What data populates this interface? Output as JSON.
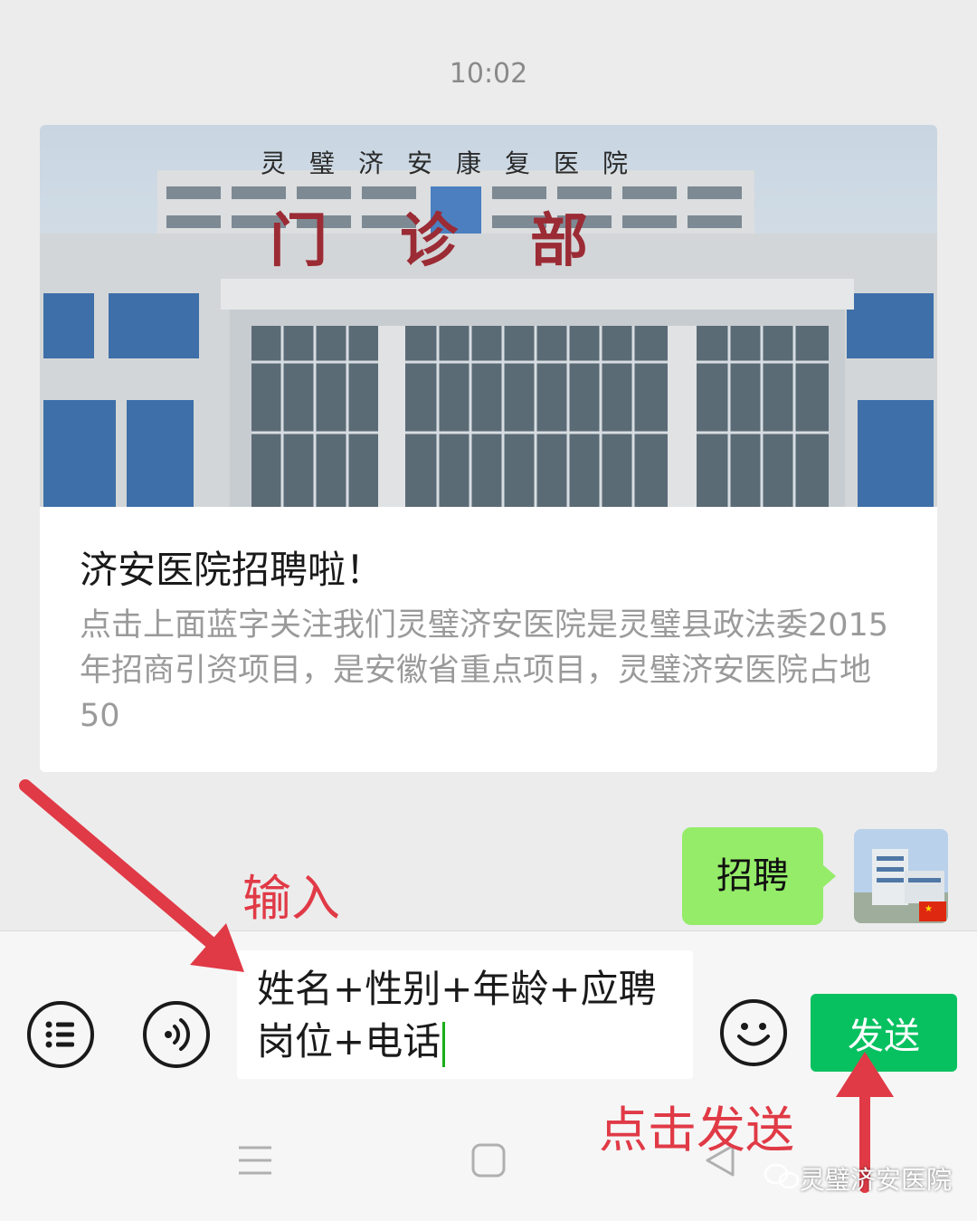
{
  "status": {
    "time": "10:02"
  },
  "article": {
    "title": "济安医院招聘啦！",
    "summary": "点击上面蓝字关注我们灵璧济安医院是灵璧县政法委2015年招商引资项目，是安徽省重点项目，灵璧济安医院占地50",
    "image_sign_top": "灵璧济安康复医院",
    "image_sign_main": "门诊部"
  },
  "message": {
    "text": "招聘",
    "bubble_color": "#95ec69"
  },
  "input_bar": {
    "value_line1": "姓名+性别+年龄+应聘",
    "value_line2": "岗位+电话",
    "send_label": "发送",
    "send_color": "#07c160",
    "icons": [
      "menu-list-icon",
      "voice-icon",
      "emoji-icon"
    ]
  },
  "nav": {
    "icons": [
      "nav-menu-icon",
      "nav-home-icon",
      "nav-back-icon"
    ]
  },
  "annotations": {
    "input_hint": "输入",
    "send_hint": "点击发送",
    "color": "#e03a46"
  },
  "watermark": {
    "text": "灵璧济安医院"
  }
}
